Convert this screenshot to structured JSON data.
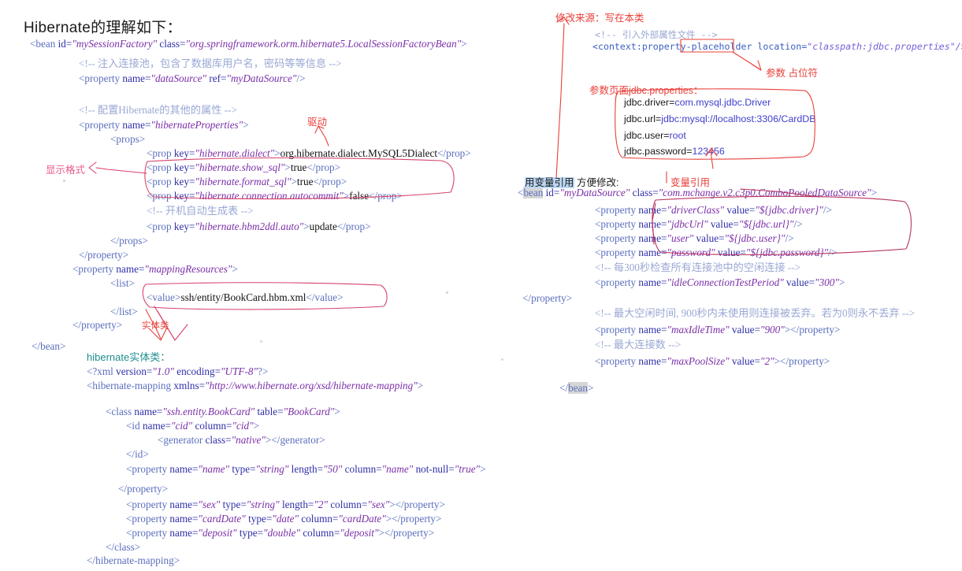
{
  "page": {
    "title": "Hibernate的理解如下：",
    "accent_red": "#e8403a",
    "accent_pink": "#e85a86",
    "code_blue": "#3b3bbf",
    "comment_gray": "#9aa8d4"
  },
  "left_code": {
    "lines": [
      "<bean id=\"mySessionFactory\" class=\"org.springframework.orm.hibernate5.LocalSessionFactoryBean\">",
      "<!-- 注入连接池，包含了数据库用户名，密码等等信息 -->",
      "<property name=\"dataSource\" ref=\"myDataSource\"/>",
      "<!-- 配置Hibernate的其他的属性 -->",
      "<property name=\"hibernateProperties\">",
      "<props>",
      "<prop key=\"hibernate.dialect\">org.hibernate.dialect.MySQL5Dialect</prop>",
      "<prop key=\"hibernate.show_sql\">true</prop>",
      "<prop key=\"hibernate.format_sql\">true</prop>",
      "<prop key=\"hibernate.connection.autocommit\">false</prop>",
      "<!-- 开机自动生成表 -->",
      "<prop key=\"hibernate.hbm2ddl.auto\">update</prop>",
      "</props>",
      "</property>",
      "<property name=\"mappingResources\">",
      "<list>",
      "<value>ssh/entity/BookCard.hbm.xml</value>",
      "</list>",
      "</property>",
      "</bean>"
    ]
  },
  "entity_section": {
    "heading": "hibernate实体类：",
    "lines": [
      "<?xml version=\"1.0\" encoding=\"UTF-8\"?>",
      "<hibernate-mapping xmlns=\"http://www.hibernate.org/xsd/hibernate-mapping\">",
      "<class name=\"ssh.entity.BookCard\" table=\"BookCard\">",
      "<id name=\"cid\" column=\"cid\">",
      "<generator class=\"native\"></generator>",
      "</id>",
      "<property name=\"name\" type=\"string\" length=\"50\" column=\"name\" not-null=\"true\">",
      "</property>",
      "<property name=\"sex\" type=\"string\" length=\"2\" column=\"sex\"></property>",
      "<property name=\"cardDate\" type=\"date\" column=\"cardDate\"></property>",
      "<property name=\"deposit\" type=\"double\" column=\"deposit\"></property>",
      "</class>",
      "</hibernate-mapping>"
    ]
  },
  "right_code": {
    "context_comment": "<!-- 引入外部属性文件 -->",
    "context_line_pre": "<context:property-",
    "context_line_token": "placeholder",
    "context_line_post": " location=",
    "context_line_value": "\"classpath:jdbc.properties\"/>",
    "bean_line": "<bean id=\"myDataSource\" class=\"com.mchange.v2.c3p0.ComboPooledDataSource\">",
    "props": [
      "<property name=\"driverClass\" value=\"${jdbc.driver}\"/>",
      "<property name=\"jdbcUrl\" value=\"${jdbc.url}\"/>",
      "<property name=\"user\" value=\"${jdbc.user}\"/>",
      "<property name=\"password\" value=\"${jdbc.password}\"/>"
    ],
    "comment_idle_test": "<!-- 每300秒检查所有连接池中的空闲连接 -->",
    "line_idle_test": "<property name=\"idleConnectionTestPeriod\" value=\"300\">",
    "comment_max_idle": "<!-- 最大空闲时间, 900秒内未使用则连接被丢弃。若为0则永不丢弃 -->",
    "line_max_idle": "<property name=\"maxIdleTime\" value=\"900\"></property>",
    "comment_max_pool": "<!-- 最大连接数 -->",
    "line_max_pool": "<property name=\"maxPoolSize\" value=\"2\"></property>",
    "close_property": "</property>",
    "close_bean": "</bean>"
  },
  "jdbc_properties": {
    "caption": "参数页面jdbc.properties：",
    "entries": [
      {
        "key": "jdbc.driver=",
        "value": "com.mysql.jdbc.Driver"
      },
      {
        "key": "jdbc.url=",
        "value": "jdbc:mysql://localhost:3306/CardDB"
      },
      {
        "key": "jdbc.user=",
        "value": "root"
      },
      {
        "key": "jdbc.password=",
        "value": "123456"
      }
    ]
  },
  "annotations": {
    "display_format": "显示格式",
    "driver": "驱动",
    "entity_class": "实体类",
    "modify_source": "修改来源：写在本类",
    "param_placeholder": "参数 占位符",
    "variable_reference": "变量引用",
    "use_variable_ref_hl": "用变量引用",
    "use_variable_ref_rest": " 方便修改:"
  }
}
